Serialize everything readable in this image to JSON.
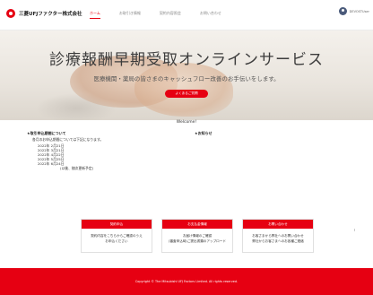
{
  "header": {
    "logo_text": "三菱UFJファクター株式会社",
    "nav": [
      {
        "label": "ホーム",
        "active": true
      },
      {
        "label": "お取引き情報",
        "active": false
      },
      {
        "label": "契約内容照会",
        "active": false
      },
      {
        "label": "お問い合わせ",
        "active": false
      }
    ],
    "user_name": "DEVOSTUser"
  },
  "hero": {
    "title": "診療報酬早期受取オンラインサービス",
    "subtitle": "医療機関・薬局の皆さまのキャッシュフロー改善のお手伝いをします。",
    "button_label": "よくあるご質問"
  },
  "welcome": "Welcome!",
  "schedule": {
    "heading": "★取引申込期間について",
    "intro": "各月のお申込期間については下記になります。",
    "dates": [
      "2022年 2月21日",
      "2022年 3月21日",
      "2022年 4月22日",
      "2022年 5月25日",
      "2022年 6月24日"
    ],
    "note": "(以後、随次更新予定)"
  },
  "notice": {
    "heading": "★お知らせ"
  },
  "cards": [
    {
      "title": "契約申込",
      "line1": "契約内容をこちらからご確認のうえ",
      "line2": "お申込ください"
    },
    {
      "title": "お支払金情報",
      "line1": "お届け情報のご確認",
      "line2": "(審査申込時)ご提出書類のアップロード"
    },
    {
      "title": "お問い合わせ",
      "line1": "お客さまから弊社へのお問い合わせ",
      "line2": "弊社からお客さまへのお各種ご連絡"
    }
  ],
  "footer": {
    "copyright": "Copyright © The Mitsubishi UFJ Factors Limited. All rights reserved."
  },
  "colors": {
    "brand_red": "#e60012"
  }
}
